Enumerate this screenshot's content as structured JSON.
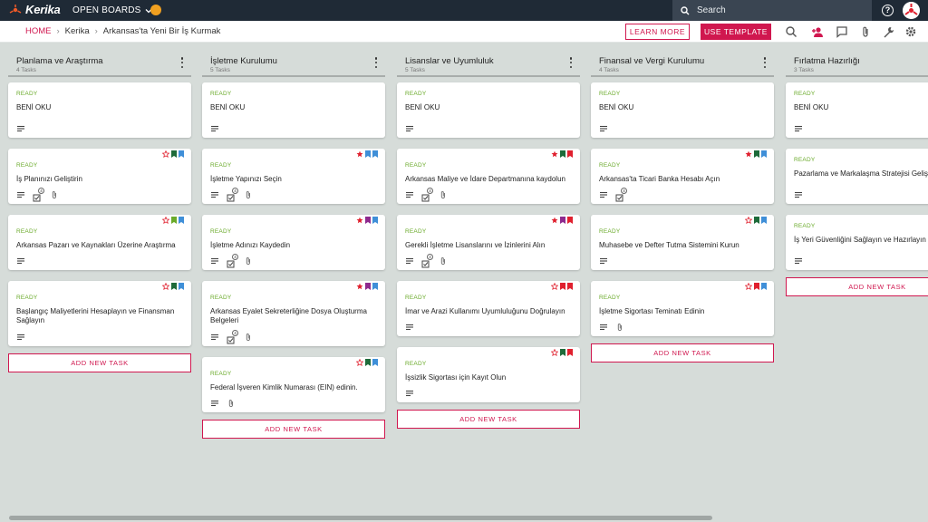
{
  "app": {
    "name": "Kerika",
    "open_boards": "OPEN BOARDS",
    "search_placeholder": "Search"
  },
  "breadcrumb": {
    "home": "HOME",
    "org": "Kerika",
    "board": "Arkansas'ta Yeni Bir İş Kurmak"
  },
  "toolbar": {
    "learn_more": "LEARN MORE",
    "use_template": "USE TEMPLATE"
  },
  "colors": {
    "accent": "#d0174f",
    "ready": "#6aaa2a",
    "star": "#e0202e",
    "bm_green": "#1e6b3a",
    "bm_blue": "#3f8fd8",
    "bm_lightgreen": "#6aaa2a",
    "bm_purple": "#8e2a8e",
    "bm_red": "#e0202e"
  },
  "add_task_label": "ADD NEW TASK",
  "columns": [
    {
      "title": "Planlama ve Araştırma",
      "count": "4 Tasks",
      "cards": [
        {
          "status": "READY",
          "title": "BENİ OKU",
          "flags": [],
          "icons": [
            "desc"
          ]
        },
        {
          "status": "READY",
          "title": "İş Planınızı Geliştirin",
          "flags": [
            "star-outline",
            "bm-green",
            "bm-blue"
          ],
          "icons": [
            "desc",
            "checklist",
            "attach"
          ],
          "check_count": "4"
        },
        {
          "status": "READY",
          "title": "Arkansas Pazarı ve Kaynakları Üzerine Araştırma",
          "flags": [
            "star-outline",
            "bm-lightgreen",
            "bm-blue"
          ],
          "icons": [
            "desc"
          ]
        },
        {
          "status": "READY",
          "title": "Başlangıç Maliyetlerini Hesaplayın ve Finansman Sağlayın",
          "flags": [
            "star-outline",
            "bm-green",
            "bm-blue"
          ],
          "icons": [
            "desc"
          ]
        }
      ]
    },
    {
      "title": "İşletme Kurulumu",
      "count": "5 Tasks",
      "cards": [
        {
          "status": "READY",
          "title": "BENİ OKU",
          "flags": [],
          "icons": [
            "desc"
          ]
        },
        {
          "status": "READY",
          "title": "İşletme Yapınızı Seçin",
          "flags": [
            "star-filled",
            "bm-blue",
            "bm-blue"
          ],
          "icons": [
            "desc",
            "checklist",
            "attach"
          ],
          "check_count": "4"
        },
        {
          "status": "READY",
          "title": "İşletme Adınızı Kaydedin",
          "flags": [
            "star-filled",
            "bm-purple",
            "bm-blue"
          ],
          "icons": [
            "desc",
            "checklist",
            "attach"
          ],
          "check_count": "4"
        },
        {
          "status": "READY",
          "title": "Arkansas Eyalet Sekreterliğine Dosya Oluşturma Belgeleri",
          "flags": [
            "star-filled",
            "bm-purple",
            "bm-blue"
          ],
          "icons": [
            "desc",
            "checklist",
            "attach"
          ],
          "check_count": "4"
        },
        {
          "status": "READY",
          "title": "Federal İşveren Kimlik Numarası (EIN) edinin.",
          "flags": [
            "star-outline",
            "bm-green",
            "bm-blue"
          ],
          "icons": [
            "desc",
            "attach"
          ]
        }
      ]
    },
    {
      "title": "Lisanslar ve Uyumluluk",
      "count": "5 Tasks",
      "cards": [
        {
          "status": "READY",
          "title": "BENİ OKU",
          "flags": [],
          "icons": [
            "desc"
          ]
        },
        {
          "status": "READY",
          "title": "Arkansas Maliye ve İdare Departmanına kaydolun",
          "flags": [
            "star-filled",
            "bm-green",
            "bm-red"
          ],
          "icons": [
            "desc",
            "checklist",
            "attach"
          ],
          "check_count": "4"
        },
        {
          "status": "READY",
          "title": "Gerekli İşletme Lisanslarını ve İzinlerini Alın",
          "flags": [
            "star-filled",
            "bm-purple",
            "bm-red"
          ],
          "icons": [
            "desc",
            "checklist",
            "attach"
          ],
          "check_count": "4"
        },
        {
          "status": "READY",
          "title": "İmar ve Arazi Kullanımı Uyumluluğunu Doğrulayın",
          "flags": [
            "star-outline",
            "bm-red",
            "bm-red"
          ],
          "icons": [
            "desc"
          ]
        },
        {
          "status": "READY",
          "title": "İşsizlik Sigortası için Kayıt Olun",
          "flags": [
            "star-outline",
            "bm-green",
            "bm-red"
          ],
          "icons": [
            "desc"
          ]
        }
      ]
    },
    {
      "title": "Finansal ve Vergi Kurulumu",
      "count": "4 Tasks",
      "cards": [
        {
          "status": "READY",
          "title": "BENİ OKU",
          "flags": [],
          "icons": [
            "desc"
          ]
        },
        {
          "status": "READY",
          "title": "Arkansas'ta Ticari Banka Hesabı Açın",
          "flags": [
            "star-filled",
            "bm-green",
            "bm-blue"
          ],
          "icons": [
            "desc",
            "checklist"
          ],
          "check_count": "4"
        },
        {
          "status": "READY",
          "title": "Muhasebe ve Defter Tutma Sistemini Kurun",
          "flags": [
            "star-outline",
            "bm-green",
            "bm-blue"
          ],
          "icons": [
            "desc"
          ]
        },
        {
          "status": "READY",
          "title": "İşletme Sigortası Teminatı Edinin",
          "flags": [
            "star-outline",
            "bm-red",
            "bm-blue"
          ],
          "icons": [
            "desc",
            "attach"
          ]
        }
      ]
    },
    {
      "title": "Fırlatma Hazırlığı",
      "count": "3 Tasks",
      "cards": [
        {
          "status": "READY",
          "title": "BENİ OKU",
          "flags": [],
          "icons": [
            "desc"
          ]
        },
        {
          "status": "READY",
          "title": "Pazarlama ve Markalaşma Stratejisi Geliştirin",
          "flags": [],
          "icons": [
            "desc"
          ]
        },
        {
          "status": "READY",
          "title": "İş Yeri Güvenliğini Sağlayın ve Hazırlayın",
          "flags": [],
          "icons": [
            "desc"
          ]
        }
      ]
    }
  ]
}
